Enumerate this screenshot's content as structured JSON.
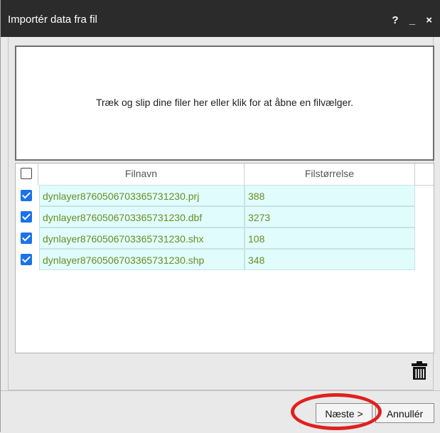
{
  "dialog": {
    "title": "Importér data fra fil",
    "help": "?",
    "minimize": "_",
    "close": "×"
  },
  "dropzone": {
    "text": "Træk og slip dine filer her eller klik for at åbne en filvælger."
  },
  "table": {
    "columns": [
      "Filnavn",
      "Filstørrelse"
    ],
    "rows": [
      {
        "checked": true,
        "name": "dynlayer8760506703365731230.prj",
        "size": "388"
      },
      {
        "checked": true,
        "name": "dynlayer8760506703365731230.dbf",
        "size": "3273"
      },
      {
        "checked": true,
        "name": "dynlayer8760506703365731230.shx",
        "size": "108"
      },
      {
        "checked": true,
        "name": "dynlayer8760506703365731230.shp",
        "size": "348"
      }
    ]
  },
  "icons": {
    "delete": "trash-icon"
  },
  "buttons": {
    "next": "Næste >",
    "cancel": "Annullér"
  },
  "colors": {
    "titlebar": "#2b2b2b",
    "row_background": "#e1fcfc",
    "row_text": "#6b8e23",
    "checkbox_checked": "#1a73e8",
    "highlight_circle": "#e0201e"
  }
}
